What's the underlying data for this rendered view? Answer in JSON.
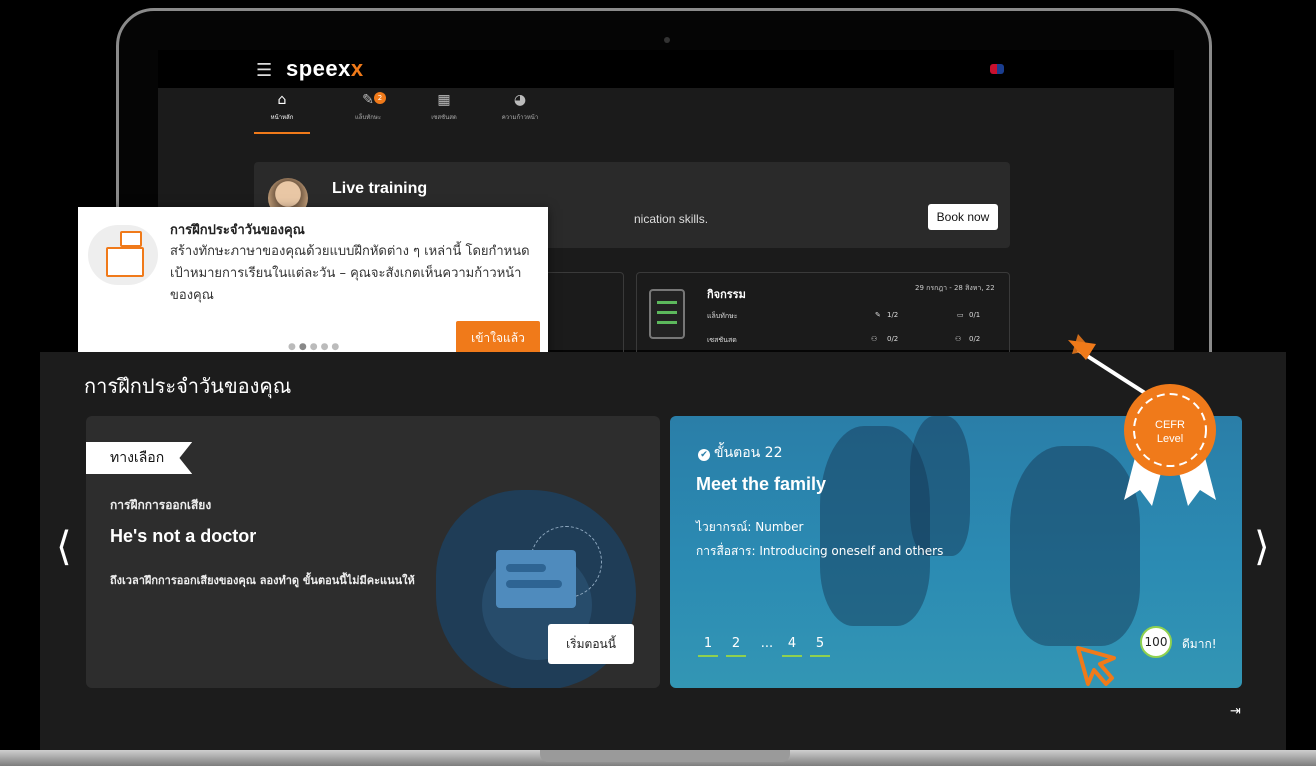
{
  "app": {
    "logo_main": "speex",
    "logo_accent": "x"
  },
  "nav": {
    "items": [
      {
        "label": "หน้าหลัก"
      },
      {
        "label": "แล็บทักษะ",
        "badge": "2"
      },
      {
        "label": "เซสชันสด"
      },
      {
        "label": "ความก้าวหน้า"
      }
    ]
  },
  "live_training": {
    "title": "Live training",
    "desc": "nication skills.",
    "button": "Book now"
  },
  "activity": {
    "title": "กิจกรรม",
    "date": "29 กรกฎา - 28 สิงหา, 22",
    "rows": [
      {
        "label": "แล็บทักษะ",
        "a": "1/2",
        "b": "0/1"
      },
      {
        "label": "เซสชันสด",
        "a": "0/2",
        "b": "0/2"
      }
    ]
  },
  "popup": {
    "title": "การฝึกประจำวันของคุณ",
    "body": "สร้างทักษะภาษาของคุณด้วยแบบฝึกหัดต่าง ๆ เหล่านี้ โดยกำหนดเป้าหมายการเรียนในแต่ละวัน – คุณจะสังเกตเห็นความก้าวหน้าของคุณ",
    "button": "เข้าใจแล้ว"
  },
  "daily": {
    "title": "การฝึกประจำวันของคุณ",
    "left_card": {
      "tag": "ทางเลือก",
      "subtitle": "การฝึกการออกเสียง",
      "heading": "He's not a doctor",
      "description": "ถึงเวลาฝึกการออกเสียงของคุณ ลองทำดู ขั้นตอนนี้ไม่มีคะแนนให้",
      "button": "เริ่มตอนนี้"
    },
    "right_card": {
      "step": "ขั้นตอน 22",
      "heading": "Meet the family",
      "grammar": "ไวยากรณ์: Number",
      "communication": "การสื่อสาร: Introducing oneself and others",
      "pages": [
        "1",
        "2",
        "...",
        "4",
        "5"
      ],
      "score": "100",
      "score_label": "ดีมาก!"
    }
  },
  "badge": {
    "line1": "CEFR",
    "line2": "Level"
  },
  "colors": {
    "accent": "#f07a1a",
    "card_blue": "#2b8bb3",
    "progress_green": "#8fd14f"
  }
}
